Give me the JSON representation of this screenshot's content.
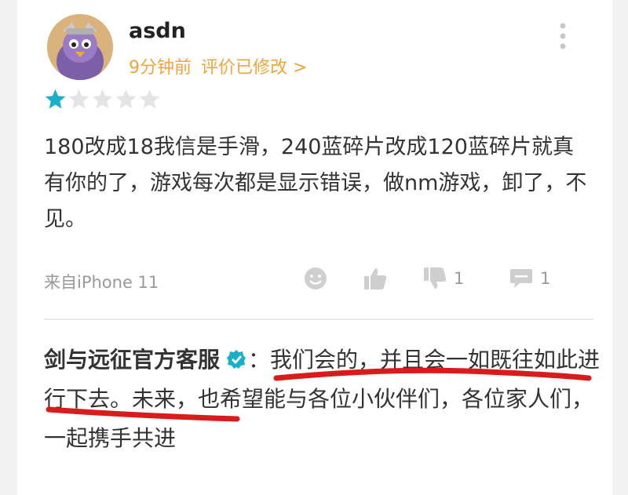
{
  "review": {
    "username": "asdn",
    "time_ago": "9分钟前",
    "edited_label": "评价已修改 >",
    "rating": 1,
    "rating_max": 5,
    "text": "180改成18我信是手滑，240蓝碎片改成120蓝碎片就真有你的了，游戏每次都是显示错误，做nm游戏，卸了，不见。",
    "device": "来自iPhone 11",
    "dislike_count": "1",
    "comment_count": "1"
  },
  "reply": {
    "author": "剑与远征官方客服",
    "text": "：我们会的，并且会一如既往如此进行下去。未来，也希望能与各位小伙伴们，各位家人们，一起携手共进"
  },
  "colors": {
    "accent_orange": "#f0a53a",
    "star_active": "#1ab1c8",
    "verified": "#1ab1c8",
    "scribble_red": "#d81c1c"
  },
  "icons": {
    "more": "more-vertical-icon",
    "emoji": "emoji-icon",
    "like": "thumbs-up-icon",
    "dislike": "thumbs-down-icon",
    "comment": "comment-icon",
    "verified": "verified-badge-icon",
    "star": "star-icon"
  }
}
